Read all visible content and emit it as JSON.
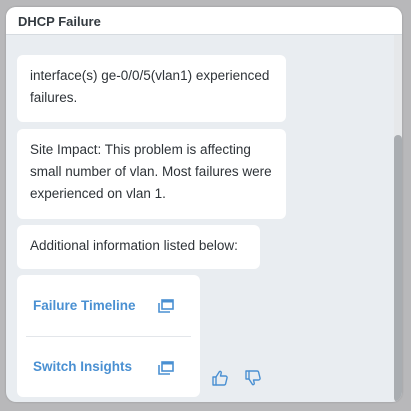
{
  "header": {
    "title": "DHCP Failure"
  },
  "messages": [
    {
      "text": "interface(s) ge-0/0/5(vlan1) experienced failures."
    },
    {
      "text": "Site Impact: This problem is affecting small number of vlan. Most failures were experienced on vlan 1."
    },
    {
      "text": "Additional information listed below:"
    }
  ],
  "links": [
    {
      "label": "Failure Timeline",
      "icon": "open-window-icon"
    },
    {
      "label": "Switch Insights",
      "icon": "open-window-icon"
    }
  ],
  "feedback": {
    "up_icon": "thumbs-up-icon",
    "down_icon": "thumbs-down-icon"
  },
  "colors": {
    "accent": "#4a90d2",
    "panel_bg": "#e9edf1",
    "bubble_bg": "#ffffff",
    "text": "#2e3338"
  }
}
